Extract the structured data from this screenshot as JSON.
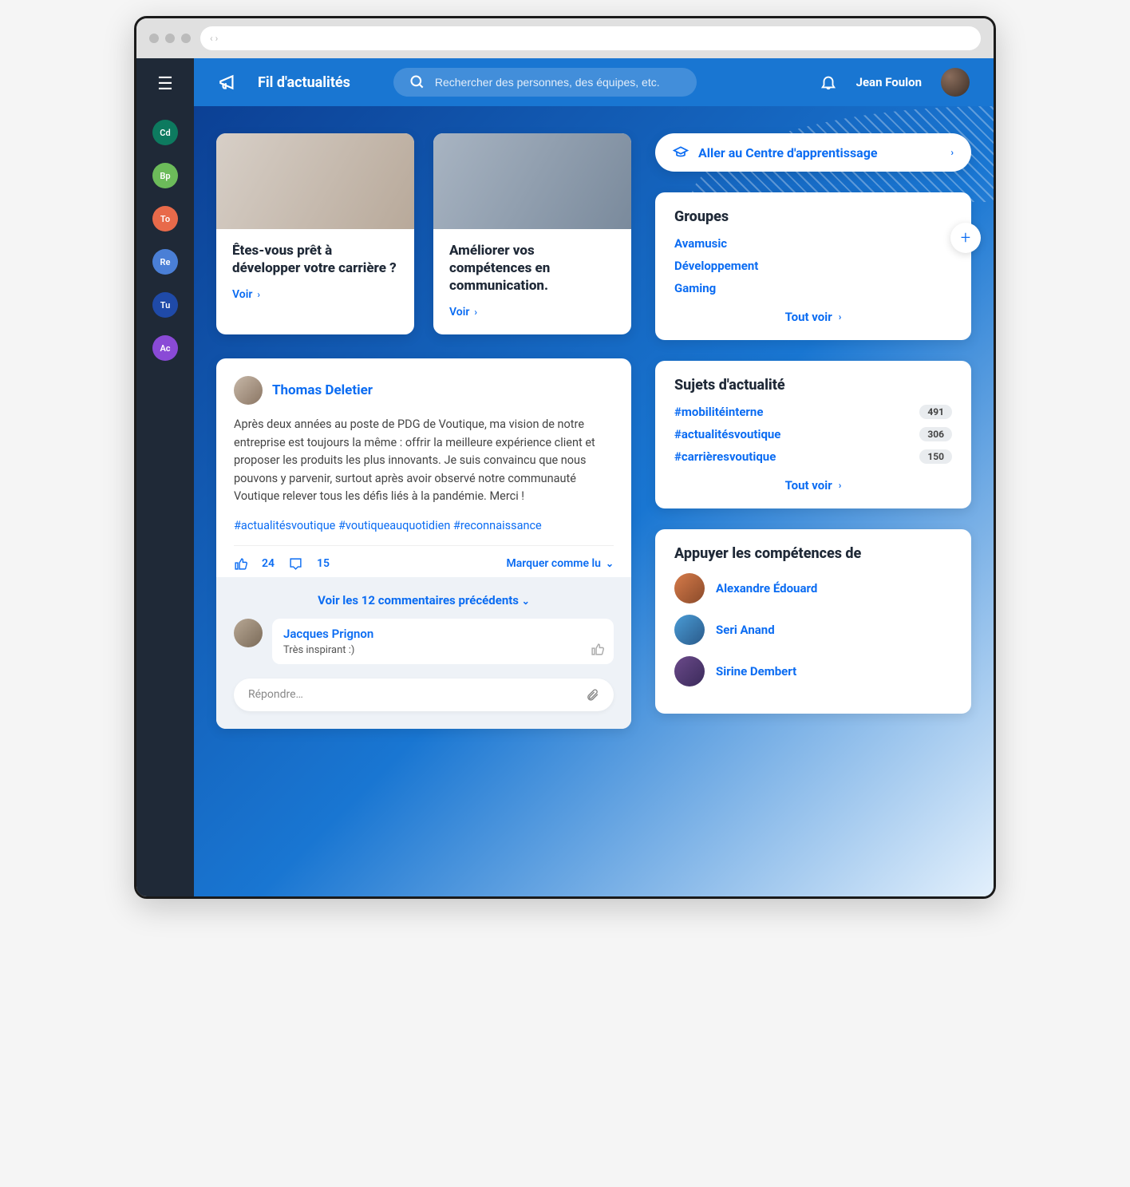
{
  "sidebar": {
    "items": [
      {
        "label": "Cd",
        "color": "#0d7a5f"
      },
      {
        "label": "Bp",
        "color": "#6cbb5a"
      },
      {
        "label": "To",
        "color": "#e86a4a"
      },
      {
        "label": "Re",
        "color": "#4a7fd6"
      },
      {
        "label": "Tu",
        "color": "#1f4aa8"
      },
      {
        "label": "Ac",
        "color": "#8a4ad6"
      }
    ]
  },
  "header": {
    "title": "Fil d'actualités",
    "search_placeholder": "Rechercher des personnes, des équipes, etc.",
    "user_name": "Jean Foulon"
  },
  "cards": [
    {
      "title": "Êtes-vous prêt à développer votre carrière ?",
      "view": "Voir"
    },
    {
      "title": "Améliorer vos compétences en communication.",
      "view": "Voir"
    }
  ],
  "post": {
    "author": "Thomas Deletier",
    "text": "Après deux années au poste de PDG de Voutique, ma vision de notre entreprise est toujours la même : offrir la meilleure expérience client et proposer les produits les plus innovants. Je suis convaincu que nous pouvons y parvenir, surtout après avoir observé notre communauté Voutique relever tous les défis liés à la pandémie. Merci !",
    "tags": "#actualitésvoutique #voutiqueauquotidien #reconnaissance",
    "likes": "24",
    "comments": "15",
    "mark_read": "Marquer comme lu",
    "view_more": "Voir les 12 commentaires précédents",
    "comment": {
      "author": "Jacques Prignon",
      "text": "Très inspirant :)"
    },
    "reply_placeholder": "Répondre…"
  },
  "learning_center": "Aller au Centre d'apprentissage",
  "groups": {
    "title": "Groupes",
    "items": [
      "Avamusic",
      "Développement",
      "Gaming"
    ],
    "see_all": "Tout voir"
  },
  "topics": {
    "title": "Sujets d'actualité",
    "items": [
      {
        "tag": "#mobilitéinterne",
        "count": "491"
      },
      {
        "tag": "#actualitésvoutique",
        "count": "306"
      },
      {
        "tag": "#carrièresvoutique",
        "count": "150"
      }
    ],
    "see_all": "Tout voir"
  },
  "endorse": {
    "title": "Appuyer les compétences de",
    "people": [
      "Alexandre Édouard",
      "Seri Anand",
      "Sirine Dembert"
    ]
  }
}
